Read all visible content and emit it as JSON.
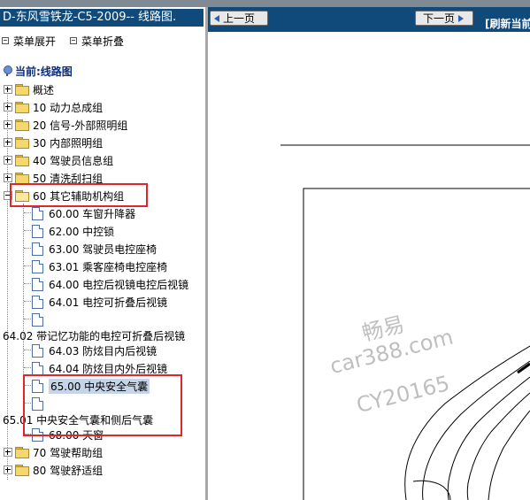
{
  "window": {
    "title": "D-东风雪铁龙-C5-2009-- 线路图."
  },
  "menu": {
    "expand_label": "菜单展开",
    "collapse_label": "菜单折叠"
  },
  "tree": {
    "current": "当前:线路图",
    "groups": [
      {
        "label": "概述"
      },
      {
        "label": "10 动力总成组"
      },
      {
        "label": "20 信号-外部照明组"
      },
      {
        "label": "30 内部照明组"
      },
      {
        "label": "40 驾驶员信息组"
      },
      {
        "label": "50 清洗刮扫组"
      },
      {
        "label": "60 其它辅助机构组",
        "expanded": true
      },
      {
        "label": "70 驾驶帮助组"
      },
      {
        "label": "80 驾驶舒适组"
      }
    ],
    "items": [
      {
        "label": "60.00 车窗升降器"
      },
      {
        "label": "62.00 中控锁"
      },
      {
        "label": "63.00 驾驶员电控座椅"
      },
      {
        "label": "63.01 乘客座椅电控座椅"
      },
      {
        "label": "64.00 电控后视镜电控后视镜"
      },
      {
        "label": "64.01 电控可折叠后视镜"
      },
      {
        "label": ""
      },
      {
        "label": "64.02 带记忆功能的电控可折叠后视镜"
      },
      {
        "label": "64.03 防炫目内后视镜"
      },
      {
        "label": "64.04 防炫目内外后视镜"
      },
      {
        "label": "65.00 中央安全气囊",
        "selected": true
      },
      {
        "label": ""
      },
      {
        "label": "65.01 中央安全气囊和侧后气囊"
      },
      {
        "label": "68.00 天窗"
      }
    ]
  },
  "nav": {
    "prev_label": "上一页",
    "next_label": "下一页",
    "refresh_label": "[刷新当前"
  },
  "watermark": {
    "line1": "畅易",
    "line2": "car388.com",
    "line3": "CY20165"
  },
  "colors": {
    "title_bar": "#0f4a7a",
    "highlight_box": "#e0262a",
    "selected_bg": "#c6d4e8"
  },
  "icons": {
    "folder": "folder-icon",
    "document": "document-icon",
    "current": "globe-icon"
  }
}
